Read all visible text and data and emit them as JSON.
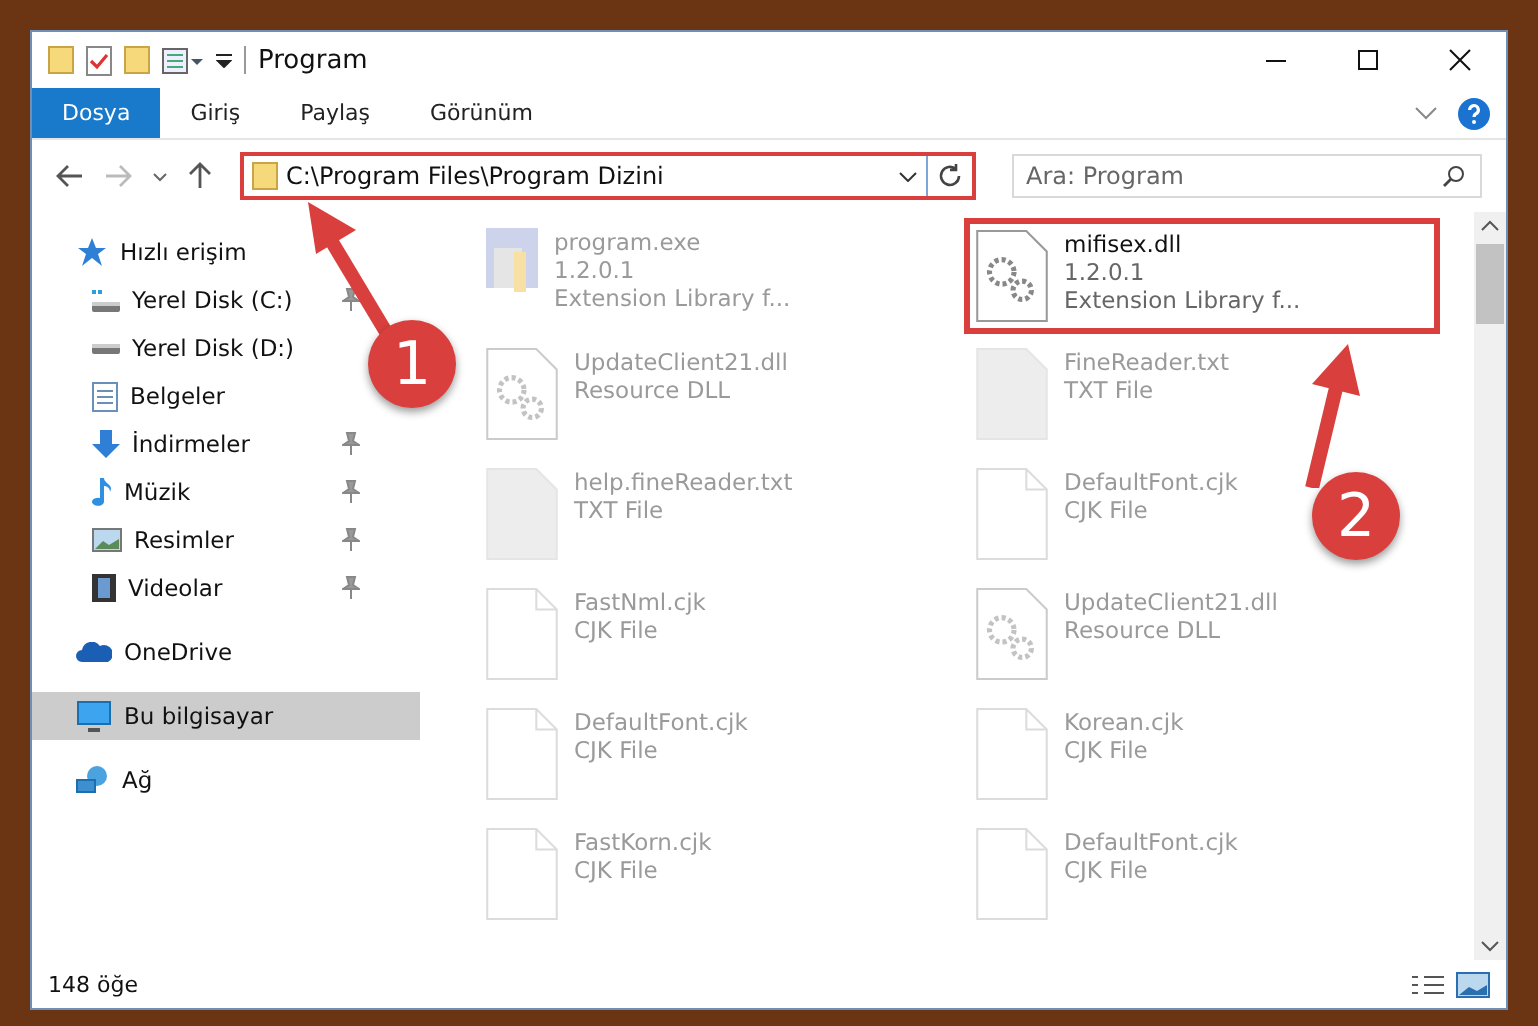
{
  "window": {
    "title": "Program"
  },
  "ribbon_tabs": [
    {
      "label": "Dosya",
      "selected": true
    },
    {
      "label": "Giriş",
      "selected": false
    },
    {
      "label": "Paylaş",
      "selected": false
    },
    {
      "label": "Görünüm",
      "selected": false
    }
  ],
  "address": {
    "path": "C:\\Program Files\\Program Dizini"
  },
  "search": {
    "placeholder": "Ara: Program"
  },
  "sidebar": {
    "items": [
      {
        "label": "Hızlı erişim",
        "kind": "star",
        "selected": false,
        "children": [
          {
            "label": "Yerel Disk (C:)",
            "kind": "disk-c",
            "pinned": true,
            "selected": false
          },
          {
            "label": "Yerel Disk (D:)",
            "kind": "disk",
            "pinned": false,
            "selected": false
          },
          {
            "label": "Belgeler",
            "kind": "doc",
            "pinned": false,
            "selected": false
          },
          {
            "label": "İndirmeler",
            "kind": "download",
            "pinned": true,
            "selected": false
          },
          {
            "label": "Müzik",
            "kind": "music",
            "pinned": true,
            "selected": false
          },
          {
            "label": "Resimler",
            "kind": "pictures",
            "pinned": true,
            "selected": false
          },
          {
            "label": "Videolar",
            "kind": "video",
            "pinned": true,
            "selected": false
          }
        ]
      },
      {
        "label": "OneDrive",
        "kind": "cloud",
        "selected": false
      },
      {
        "label": "Bu bilgisayar",
        "kind": "pc",
        "selected": true
      },
      {
        "label": "Ağ",
        "kind": "network",
        "selected": false
      }
    ]
  },
  "files": [
    {
      "name": "program.exe",
      "lines": [
        "1.2.0.1",
        "Extension Library f..."
      ],
      "kind": "exe",
      "faded": true,
      "highlighted": false
    },
    {
      "name": "mifisex.dll",
      "lines": [
        "1.2.0.1",
        "Extension Library f..."
      ],
      "kind": "dll",
      "faded": false,
      "highlighted": true
    },
    {
      "name": "UpdateClient21.dll",
      "lines": [
        "Resource DLL"
      ],
      "kind": "dll",
      "faded": true,
      "highlighted": false
    },
    {
      "name": "FineReader.txt",
      "lines": [
        "TXT File"
      ],
      "kind": "txt",
      "faded": true,
      "highlighted": false
    },
    {
      "name": "help.fineReader.txt",
      "lines": [
        "TXT File"
      ],
      "kind": "txt",
      "faded": true,
      "highlighted": false
    },
    {
      "name": "DefaultFont.cjk",
      "lines": [
        "CJK File"
      ],
      "kind": "file",
      "faded": true,
      "highlighted": false
    },
    {
      "name": "FastNml.cjk",
      "lines": [
        "CJK File"
      ],
      "kind": "file",
      "faded": true,
      "highlighted": false
    },
    {
      "name": "UpdateClient21.dll",
      "lines": [
        "Resource DLL"
      ],
      "kind": "dll",
      "faded": true,
      "highlighted": false
    },
    {
      "name": "DefaultFont.cjk",
      "lines": [
        "CJK File"
      ],
      "kind": "file",
      "faded": true,
      "highlighted": false
    },
    {
      "name": "Korean.cjk",
      "lines": [
        "CJK File"
      ],
      "kind": "file",
      "faded": true,
      "highlighted": false
    },
    {
      "name": "FastKorn.cjk",
      "lines": [
        "CJK File"
      ],
      "kind": "file",
      "faded": true,
      "highlighted": false
    },
    {
      "name": "DefaultFont.cjk",
      "lines": [
        "CJK File"
      ],
      "kind": "file",
      "faded": true,
      "highlighted": false
    }
  ],
  "status_bar": {
    "count": "148 öğe"
  },
  "annotations": [
    {
      "number": "1"
    },
    {
      "number": "2"
    }
  ]
}
